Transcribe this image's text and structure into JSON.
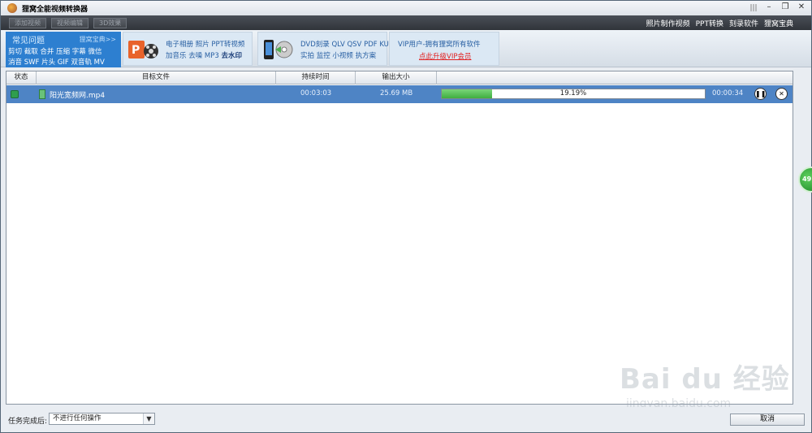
{
  "app": {
    "title": "狸窝全能视频转换器"
  },
  "toolbar": {
    "buttons": [
      "添加视频",
      "视频编辑",
      "3D效果"
    ]
  },
  "top_links": [
    "照片制作视频",
    "PPT转换",
    "刻录软件",
    "狸窝宝典"
  ],
  "faq": {
    "title": "常见问题",
    "more": "狸窝宝典>>",
    "row1": "剪切 截取 合并 压缩 字幕 微信",
    "row2": "消音 SWF 片头 GIF 双音轨 MV"
  },
  "promo": {
    "block1": {
      "line1": "电子相册 照片 PPT转视频",
      "line2_normal": "加音乐 去噪 MP3 ",
      "line2_bold": "去水印"
    },
    "block2": {
      "line1": "DVD刻录 QLV QSV PDF KUX",
      "line2": "实拍 监控 小视频 执方案"
    },
    "block3": {
      "line1": "VIP用户-拥有狸窝所有软件",
      "line2": "点此升级VIP会员"
    }
  },
  "table": {
    "headers": {
      "status": "状态",
      "file": "目标文件",
      "duration": "持续时间",
      "size": "输出大小"
    },
    "rows": [
      {
        "file": "阳光宽频网.mp4",
        "duration": "00:03:03",
        "size": "25.69 MB",
        "progress": 19.19,
        "progress_text": "19.19%",
        "remaining": "00:00:34"
      }
    ]
  },
  "side_bubble": {
    "text": "49"
  },
  "bottom": {
    "after_label": "任务完成后:",
    "after_value": "不进行任何操作",
    "cancel": "取消"
  },
  "watermark": {
    "main": "Bai du 经验",
    "sub": "jingyan.baidu.com"
  },
  "colors": {
    "selected_row": "#4e84c5",
    "progress_fill": "#3fae3f",
    "faq_bg": "#2d7fd0",
    "vip_link": "#e21f1f"
  }
}
